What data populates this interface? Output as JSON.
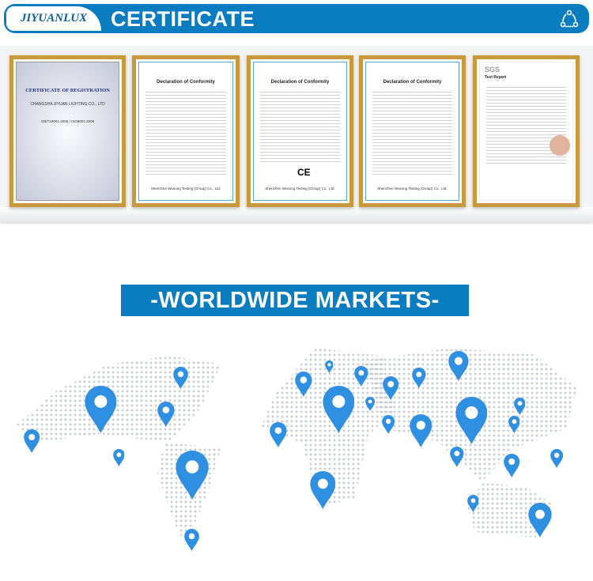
{
  "header": {
    "brand": "JIYUANLUX",
    "title": "CERTIFICATE",
    "share_icon": "share-icon"
  },
  "certificates": [
    {
      "title": "CERTIFICATE OF REGISTRATION",
      "subtitle": "CHANGSHA JIYUAN LIGHTING CO., LTD",
      "standard": "GB/T19001-2008 / ISO9001:2008"
    },
    {
      "title": "Declaration of Conformity",
      "issuer": "Shenzhen Wusong Testing (Group) Co., Ltd."
    },
    {
      "title": "Declaration of Conformity",
      "issuer": "Shenzhen Wusong Testing (Group) Co., Ltd.",
      "mark": "CE"
    },
    {
      "title": "Declaration of Conformity",
      "issuer": "Shenzhen Wusong Testing (Group) Co., Ltd."
    },
    {
      "title": "Test Report",
      "logo": "SGS"
    }
  ],
  "markets": {
    "banner": "-WORLDWIDE MARKETS-",
    "pin_color": "#2f8fe0",
    "accent": "#0a7dc0"
  }
}
